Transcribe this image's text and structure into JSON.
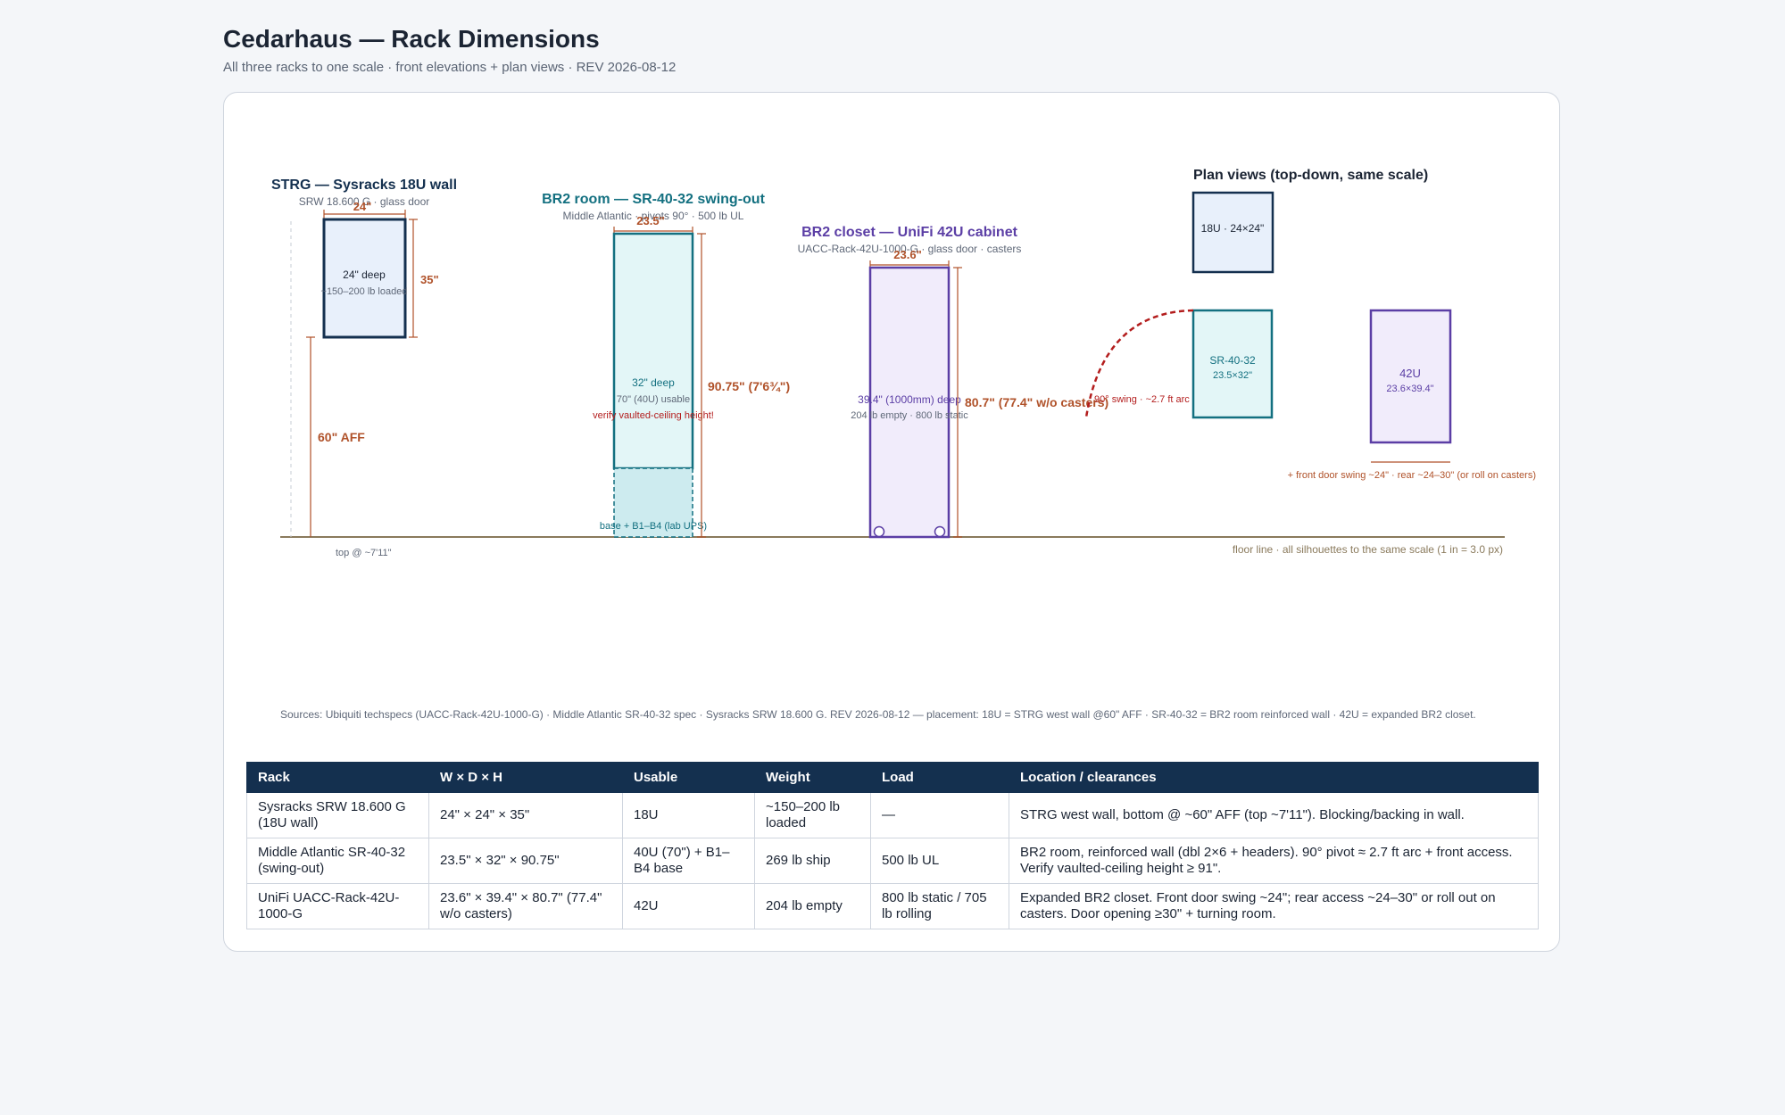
{
  "page": {
    "title": "Cedarhaus — Rack Dimensions",
    "subtitle": "All three racks to one scale · front elevations + plan views · REV 2026-08-12"
  },
  "colors": {
    "strg": "#14304f",
    "br2room": "#137080",
    "br2closet": "#5b3ea5",
    "dimension": "#b0522a",
    "warning": "#b31d1d",
    "floor": "#8a7a5c"
  },
  "diagram": {
    "strg": {
      "title": "STRG — Sysracks 18U wall",
      "subtitle": "SRW 18.600 G · glass door",
      "width": "24\"",
      "height": "35\"",
      "depth": "24\" deep",
      "weight": "~150–200 lb loaded",
      "aff": "60\" AFF",
      "top_note": "top @ ~7'11\""
    },
    "br2room": {
      "title": "BR2 room — SR-40-32 swing-out",
      "subtitle": "Middle Atlantic · pivots 90° · 500 lb UL",
      "width": "23.5\"",
      "height": "90.75\" (7'6¾\")",
      "depth": "32\" deep",
      "usable": "70\" (40U) usable",
      "warning": "verify vaulted-ceiling height!",
      "base": "base + B1–B4 (lab UPS)"
    },
    "br2closet": {
      "title": "BR2 closet — UniFi 42U cabinet",
      "subtitle": "UACC-Rack-42U-1000-G · glass door · casters",
      "width": "23.6\"",
      "height": "80.7\" (77.4\" w/o casters)",
      "depth": "39.4\" (1000mm) deep",
      "weight": "204 lb empty · 800 lb static"
    },
    "plan": {
      "title": "Plan views (top-down, same scale)",
      "r18u": "18U · 24×24\"",
      "sr_name": "SR-40-32",
      "sr_dims": "23.5×32\"",
      "u42_name": "42U",
      "u42_dims": "23.6×39.4\"",
      "swing": "90° swing · ~2.7 ft arc",
      "clearance": "+ front door swing ~24\" · rear ~24–30\" (or roll on casters)"
    },
    "floor_label": "floor line · all silhouettes to the same scale (1 in = 3.0 px)"
  },
  "sources": "Sources: Ubiquiti techspecs (UACC-Rack-42U-1000-G) · Middle Atlantic SR-40-32 spec · Sysracks SRW 18.600 G. REV 2026-08-12 — placement: 18U = STRG west wall @60\" AFF · SR-40-32 = BR2 room reinforced wall · 42U = expanded BR2 closet.",
  "table": {
    "headers": [
      "Rack",
      "W × D × H",
      "Usable",
      "Weight",
      "Load",
      "Location / clearances"
    ],
    "rows": [
      [
        "Sysracks SRW 18.600 G (18U wall)",
        "24\" × 24\" × 35\"",
        "18U",
        "~150–200 lb loaded",
        "—",
        "STRG west wall, bottom @ ~60\" AFF (top ~7'11\"). Blocking/backing in wall."
      ],
      [
        "Middle Atlantic SR-40-32 (swing-out)",
        "23.5\" × 32\" × 90.75\"",
        "40U (70\") + B1–B4 base",
        "269 lb ship",
        "500 lb UL",
        "BR2 room, reinforced wall (dbl 2×6 + headers). 90° pivot ≈ 2.7 ft arc + front access. Verify vaulted-ceiling height ≥ 91\"."
      ],
      [
        "UniFi UACC-Rack-42U-1000-G",
        "23.6\" × 39.4\" × 80.7\" (77.4\" w/o casters)",
        "42U",
        "204 lb empty",
        "800 lb static / 705 lb rolling",
        "Expanded BR2 closet. Front door swing ~24\"; rear access ~24–30\" or roll out on casters. Door opening ≥30\" + turning room."
      ]
    ]
  }
}
